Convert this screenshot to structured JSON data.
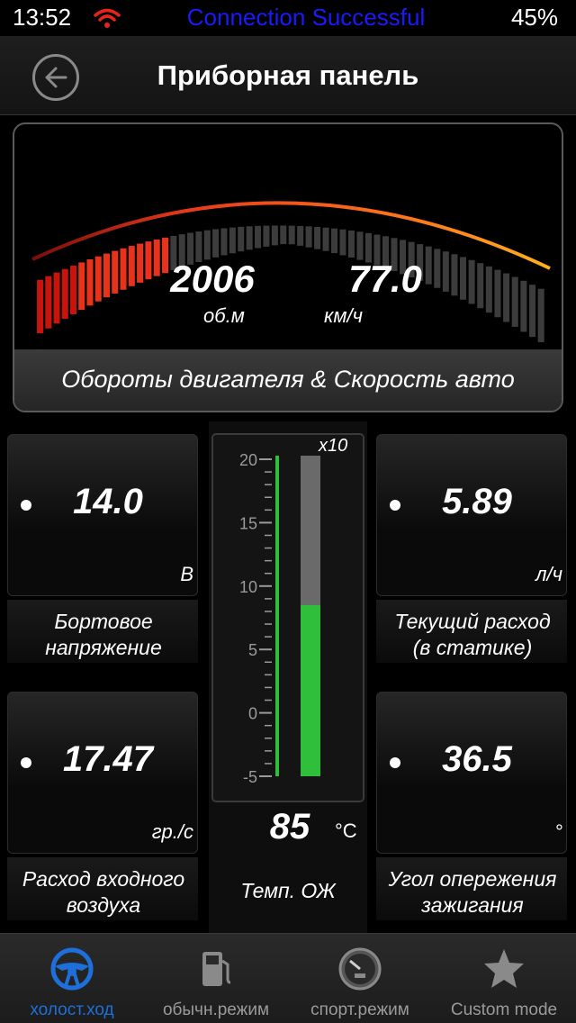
{
  "status_bar": {
    "time": "13:52",
    "message": "Connection Successful",
    "battery": "45%",
    "message_color": "#1a1aff"
  },
  "header": {
    "title": "Приборная панель",
    "back_icon": "back-arrow-icon"
  },
  "main_gauge": {
    "rpm_value": "2006",
    "rpm_unit": "об.м",
    "speed_value": "77.0",
    "speed_unit": "км/ч",
    "label": "Обороты двигателя & Скорость авто",
    "rpm_fill_fraction": 0.26
  },
  "tiles": {
    "voltage": {
      "value": "14.0",
      "unit": "В",
      "label_line1": "Бортовое",
      "label_line2": "напряжение"
    },
    "fuel": {
      "value": "5.89",
      "unit": "л/ч",
      "label_line1": "Текущий расход",
      "label_line2": "(в статике)"
    },
    "airflow": {
      "value": "17.47",
      "unit": "гр./с",
      "label_line1": "Расход входного",
      "label_line2": "воздуха"
    },
    "timing": {
      "value": "36.5",
      "unit": "°",
      "label_line1": "Угол опережения",
      "label_line2": "зажигания"
    }
  },
  "coolant": {
    "multiplier": "x10",
    "scale_labels": [
      "20",
      "15",
      "10",
      "5",
      "0",
      "-5"
    ],
    "value": "85",
    "unit": "°C",
    "label": "Темп. ОЖ",
    "fill_value": 8.5,
    "scale_min": -5,
    "scale_max": 20,
    "fill_color": "#2fbf3a"
  },
  "tabs": [
    {
      "label": "холост.ход",
      "icon": "steering-wheel-icon",
      "active": true
    },
    {
      "label": "обычн.режим",
      "icon": "fuel-pump-icon",
      "active": false
    },
    {
      "label": "спорт.режим",
      "icon": "speedometer-icon",
      "active": false
    },
    {
      "label": "Custom mode",
      "icon": "star-icon",
      "active": false
    }
  ],
  "colors": {
    "accent": "#1e6fd9",
    "gauge_red": "#e8231a",
    "gauge_orange": "#ff8a1a"
  }
}
